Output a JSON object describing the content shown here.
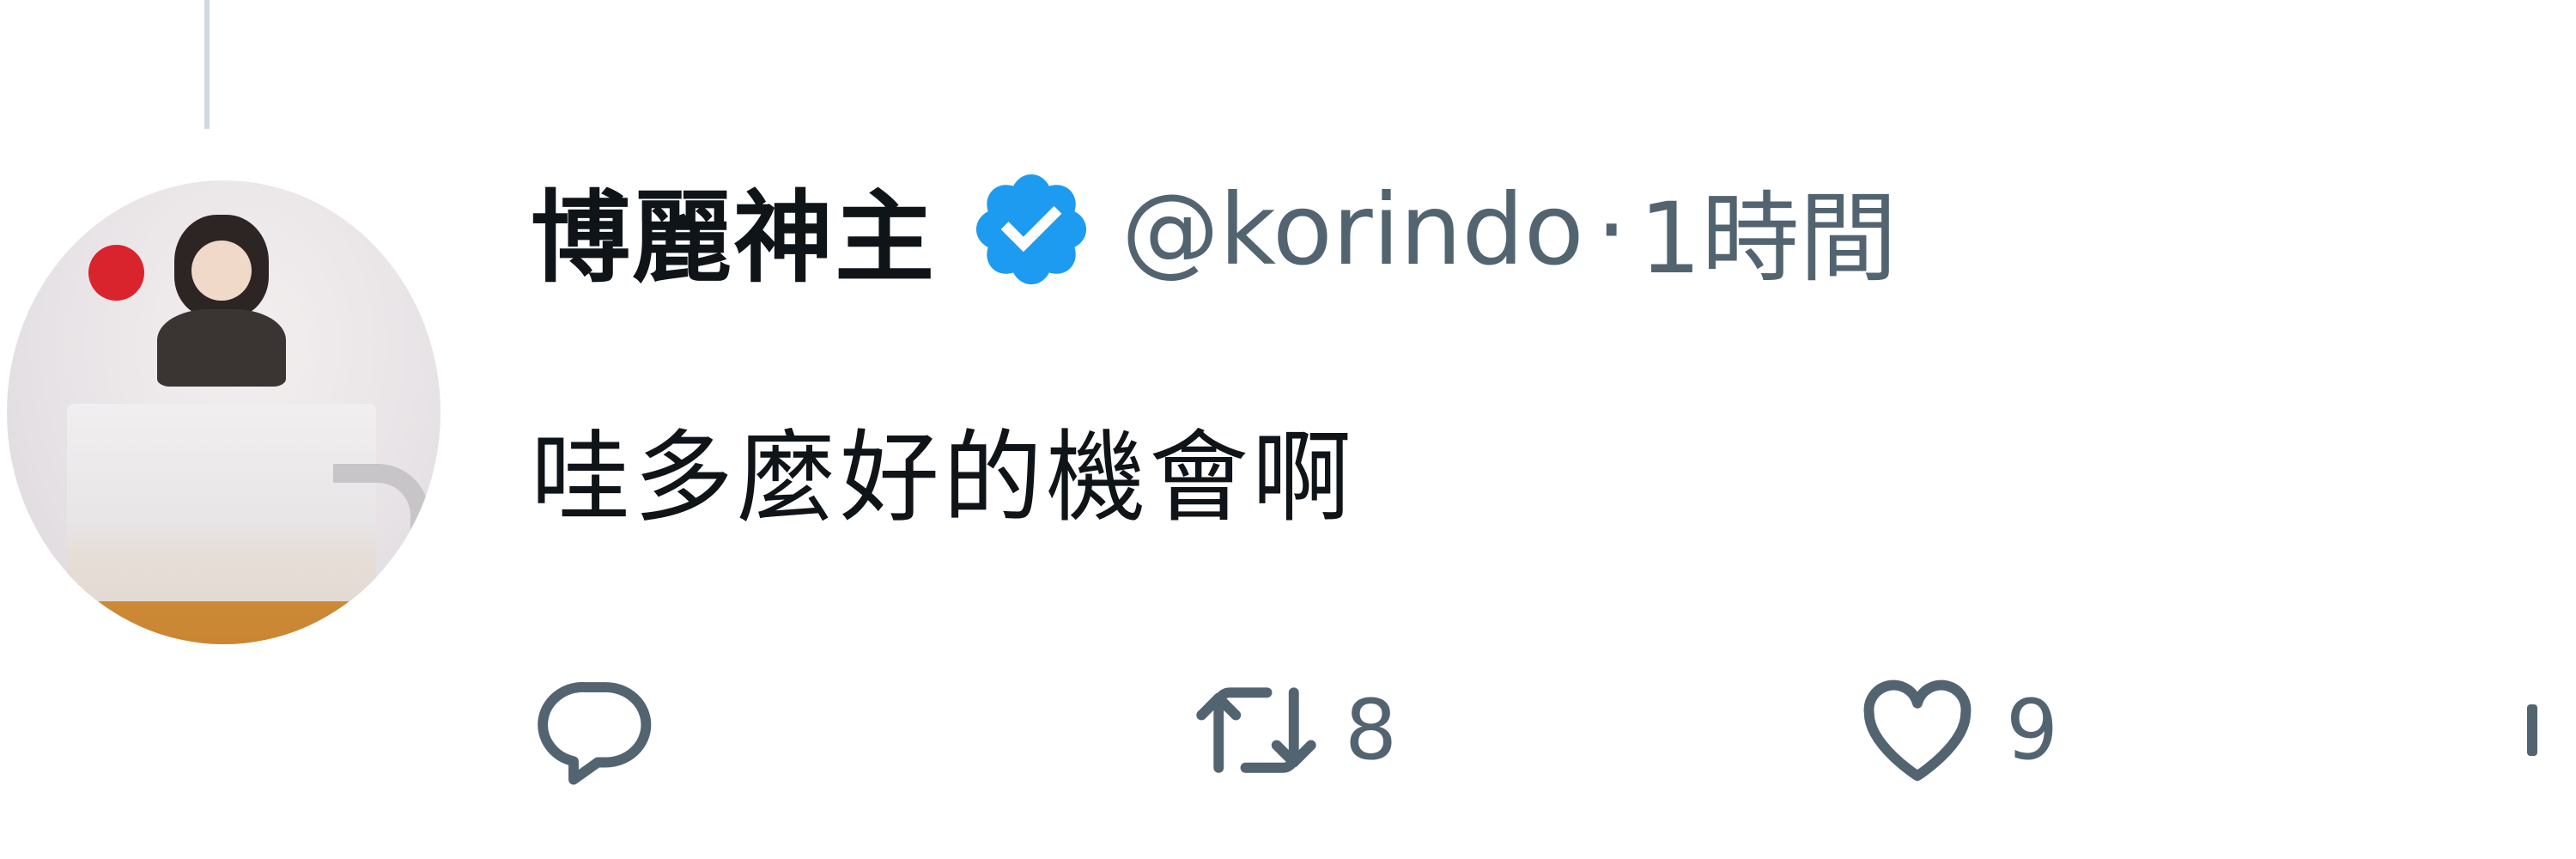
{
  "tweet": {
    "display_name": "博麗神主",
    "verified": true,
    "handle": "@korindo",
    "separator": "·",
    "time": "1時間",
    "text": "哇多麼好的機會啊"
  },
  "actions": {
    "reply_icon": "reply-icon",
    "retweet_icon": "retweet-icon",
    "retweet_count": "8",
    "like_icon": "heart-icon",
    "like_count": "9",
    "more_icon": "more-icon"
  },
  "colors": {
    "text_primary": "#0f1419",
    "text_secondary": "#536471",
    "verified_blue": "#1d9bf0",
    "background": "#ffffff"
  }
}
